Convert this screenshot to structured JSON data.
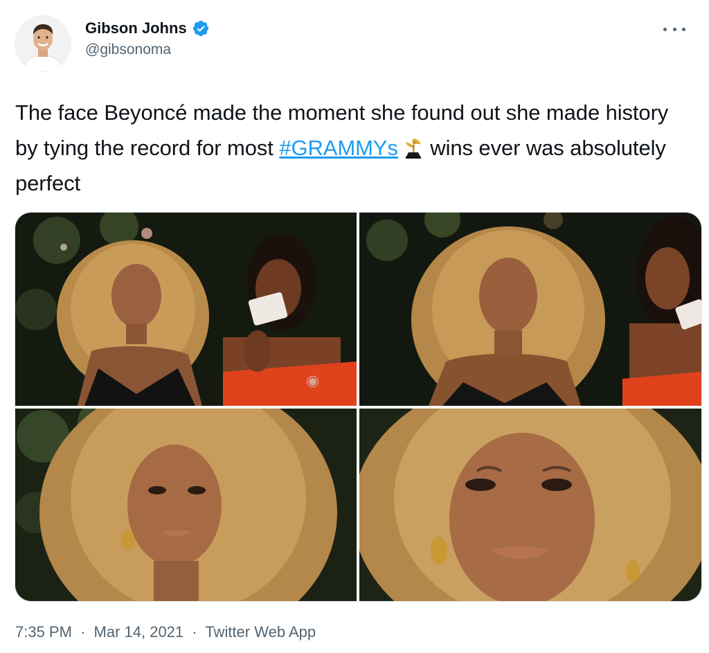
{
  "author": {
    "display_name": "Gibson Johns",
    "handle": "@gibsonoma",
    "verified": true,
    "avatar_icon": "avatar-photo"
  },
  "more_icon": "ellipsis-icon",
  "tweet": {
    "text_before": "The face Beyoncé made the moment she found out she made history by tying the record for most ",
    "hashtag": "#GRAMMYs",
    "text_after": " wins ever was absolutely perfect",
    "emoji": "trophy-gramophone-icon"
  },
  "media": {
    "photo_count": 4,
    "photos": [
      {
        "subject": "photo-1"
      },
      {
        "subject": "photo-2"
      },
      {
        "subject": "photo-3"
      },
      {
        "subject": "photo-4"
      }
    ]
  },
  "footer": {
    "time": "7:35 PM",
    "date": "Mar 14, 2021",
    "source": "Twitter Web App",
    "separator": "·"
  },
  "colors": {
    "accent": "#1d9bf0",
    "secondary_text": "#536471",
    "primary_text": "#0f1419"
  }
}
